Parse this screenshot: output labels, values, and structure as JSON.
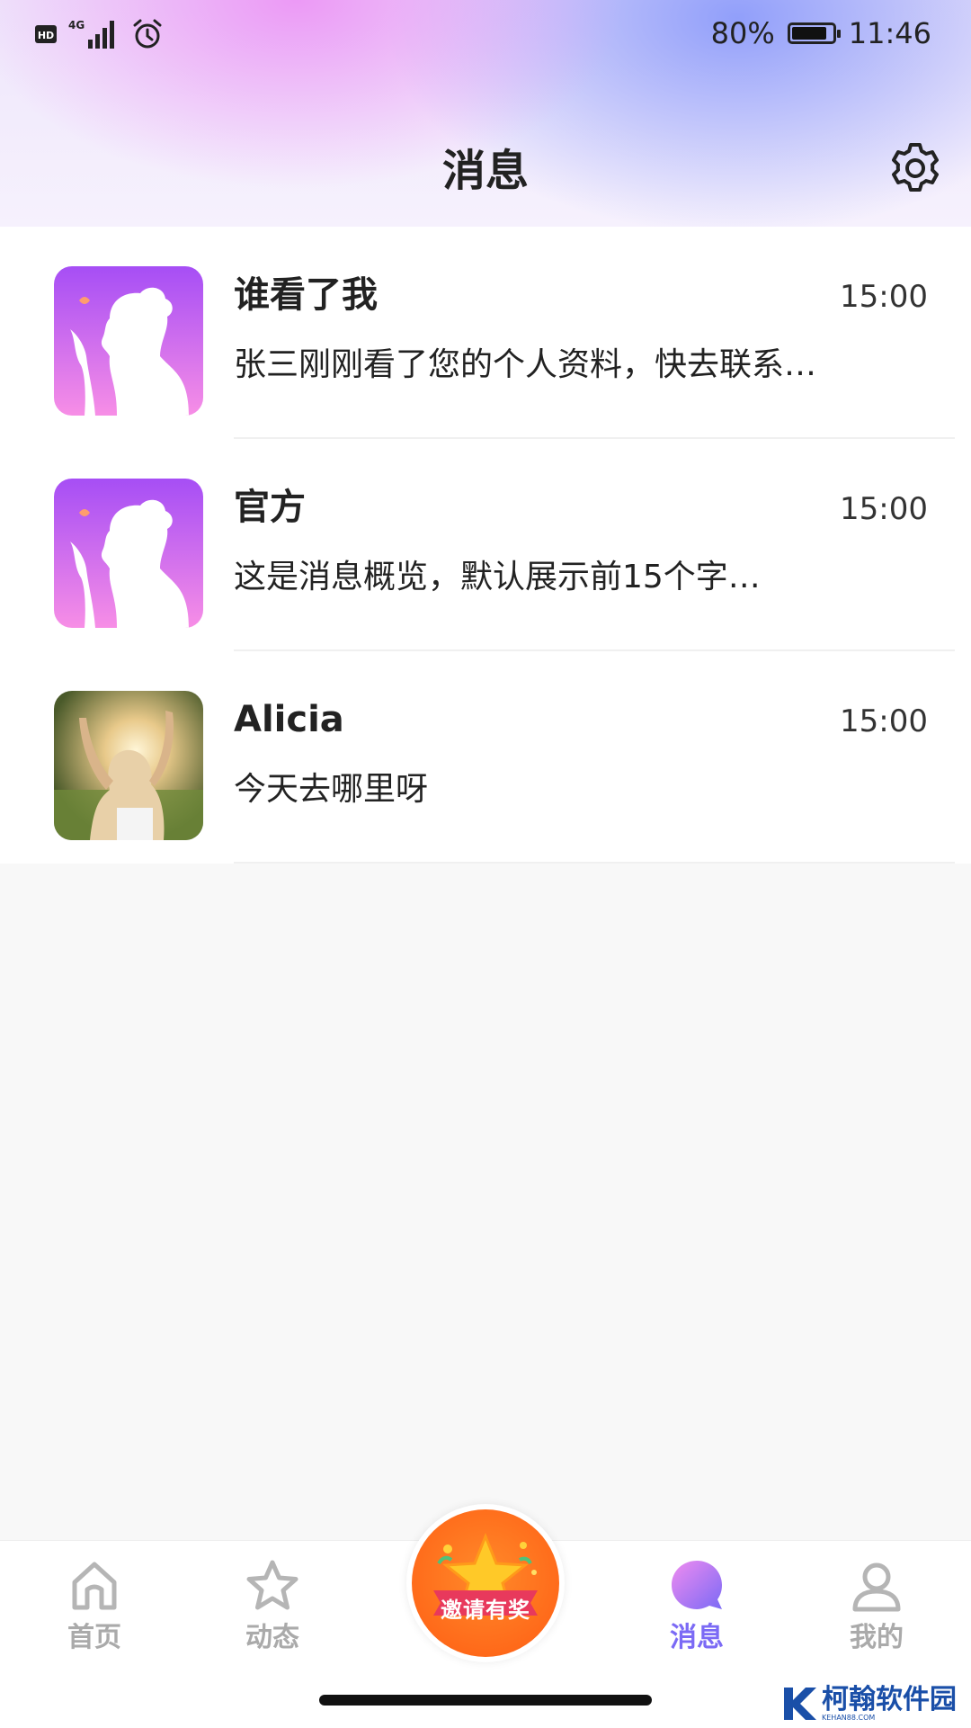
{
  "status_bar": {
    "left_icons": [
      "hd-icon",
      "signal-4g-icon",
      "alarm-icon"
    ],
    "network": "4G",
    "hd": "HD",
    "battery": "80%",
    "battery_level": 0.8,
    "time": "11:46"
  },
  "header": {
    "title": "消息",
    "settings_icon": "gear-icon"
  },
  "messages": [
    {
      "name": "谁看了我",
      "time": "15:00",
      "preview": "张三刚刚看了您的个人资料，快去联系…",
      "avatar": "app-logo-avatar"
    },
    {
      "name": "官方",
      "time": "15:00",
      "preview": "这是消息概览，默认展示前15个字…",
      "avatar": "app-logo-avatar"
    },
    {
      "name": "Alicia",
      "time": "15:00",
      "preview": "今天去哪里呀",
      "avatar": "photo-avatar"
    }
  ],
  "tabbar": {
    "tabs": [
      {
        "label": "首页",
        "icon": "home-icon",
        "active": false
      },
      {
        "label": "动态",
        "icon": "star-icon",
        "active": false
      },
      {
        "label": "消息",
        "icon": "chat-bubble-icon",
        "active": true
      },
      {
        "label": "我的",
        "icon": "person-icon",
        "active": false
      }
    ],
    "center_button": {
      "label": "邀请有奖",
      "icon": "gift-star-icon"
    }
  },
  "watermark": {
    "text": "柯翰软件园",
    "sub": "KEHAN88.COM"
  },
  "colors": {
    "accent": "#7b6af5",
    "header_pink": "#eb8cf5",
    "header_blue": "#8c9bfa",
    "invite_orange": "#ff6a1a",
    "tab_inactive": "#aaaaaa"
  }
}
